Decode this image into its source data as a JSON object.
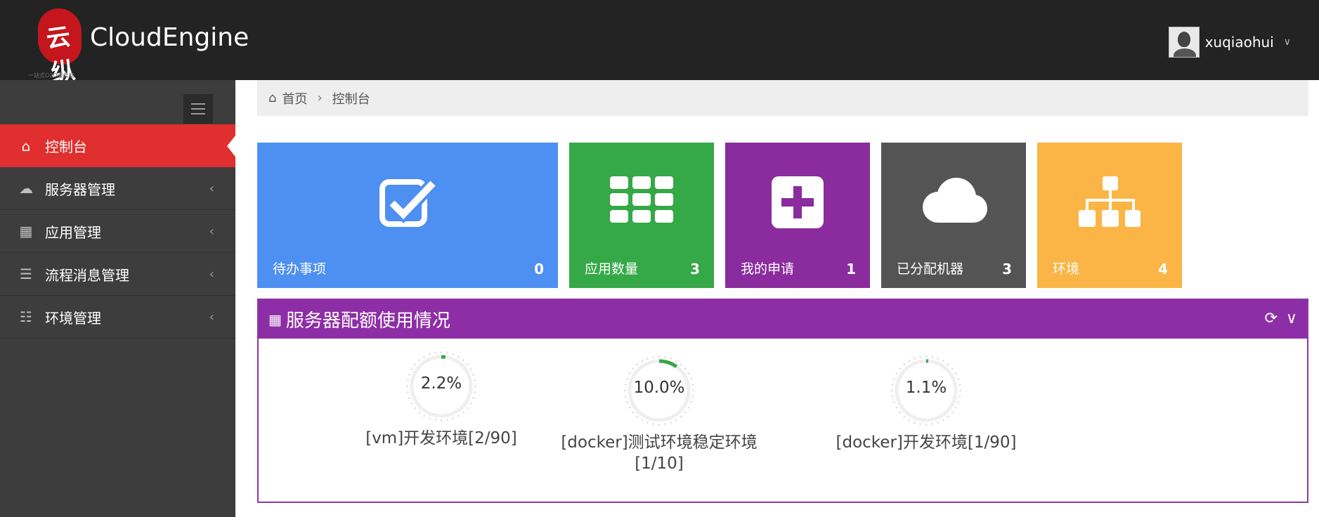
{
  "header": {
    "logo_glyph": "云纵",
    "logo_sub": "一站式O2O服务商",
    "brand": "CloudEngine",
    "username": "xuqiaohui"
  },
  "sidebar": {
    "items": [
      {
        "label": "控制台",
        "icon": "home-icon",
        "active": true
      },
      {
        "label": "服务器管理",
        "icon": "cloud-icon"
      },
      {
        "label": "应用管理",
        "icon": "grid-icon"
      },
      {
        "label": "流程消息管理",
        "icon": "tasks-icon"
      },
      {
        "label": "环境管理",
        "icon": "sitemap-icon"
      }
    ]
  },
  "breadcrumb": {
    "home": "首页",
    "current": "控制台"
  },
  "tiles": [
    {
      "label": "待办事项",
      "count": "0",
      "color": "#4e8ff2",
      "icon": "check-square-icon"
    },
    {
      "label": "应用数量",
      "count": "3",
      "color": "#35a847",
      "icon": "th-icon"
    },
    {
      "label": "我的申请",
      "count": "1",
      "color": "#8a2c9d",
      "icon": "plus-square-icon"
    },
    {
      "label": "已分配机器",
      "count": "3",
      "color": "#545454",
      "icon": "cloud-icon"
    },
    {
      "label": "环境",
      "count": "4",
      "color": "#fbb546",
      "icon": "sitemap-icon"
    }
  ],
  "panel": {
    "title": "服务器配额使用情况",
    "gauges": [
      {
        "value": "2.2%",
        "percent": 2.2,
        "label": "[vm]开发环境[2/90]"
      },
      {
        "value": "10.0%",
        "percent": 10.0,
        "label": "[docker]测试环境稳定环境[1/10]"
      },
      {
        "value": "1.1%",
        "percent": 1.1,
        "label": "[docker]开发环境[1/90]"
      }
    ]
  },
  "colors": {
    "header_bg": "#232323",
    "sidebar_bg": "#3d3d3d",
    "active_nav": "#e12e2e",
    "panel_head": "#8e2ea6",
    "gauge_fill": "#35a847"
  }
}
